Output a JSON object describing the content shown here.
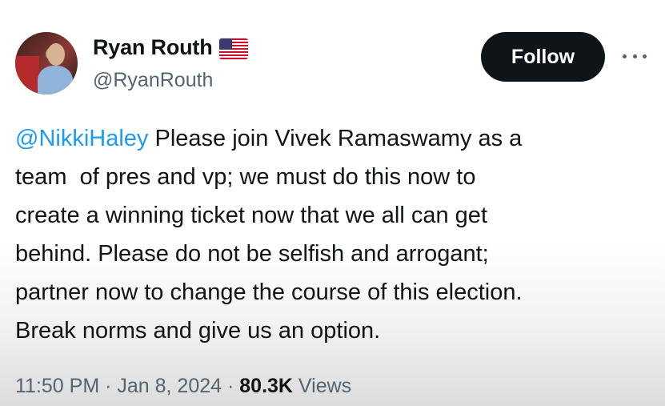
{
  "author": {
    "display_name": "Ryan Routh",
    "handle": "@RyanRouth",
    "badge_icon": "us-flag-icon"
  },
  "actions": {
    "follow_label": "Follow",
    "more_icon": "more-options-icon"
  },
  "tweet": {
    "mention": "@NikkiHaley",
    "body": " Please join Vivek Ramaswamy as a\nteam  of pres and vp; we must do this now to\ncreate a winning ticket now that we all can get\nbehind. Please do not be selfish and arrogant;\npartner now to change the course of this election.\nBreak norms and give us an option."
  },
  "meta": {
    "time": "11:50 PM",
    "separator": " · ",
    "date": "Jan 8, 2024",
    "views_count": "80.3K",
    "views_label": " Views"
  },
  "colors": {
    "link": "#1d9bf0",
    "text": "#0f1419",
    "secondary": "#536471",
    "button_bg": "#0f1419"
  }
}
